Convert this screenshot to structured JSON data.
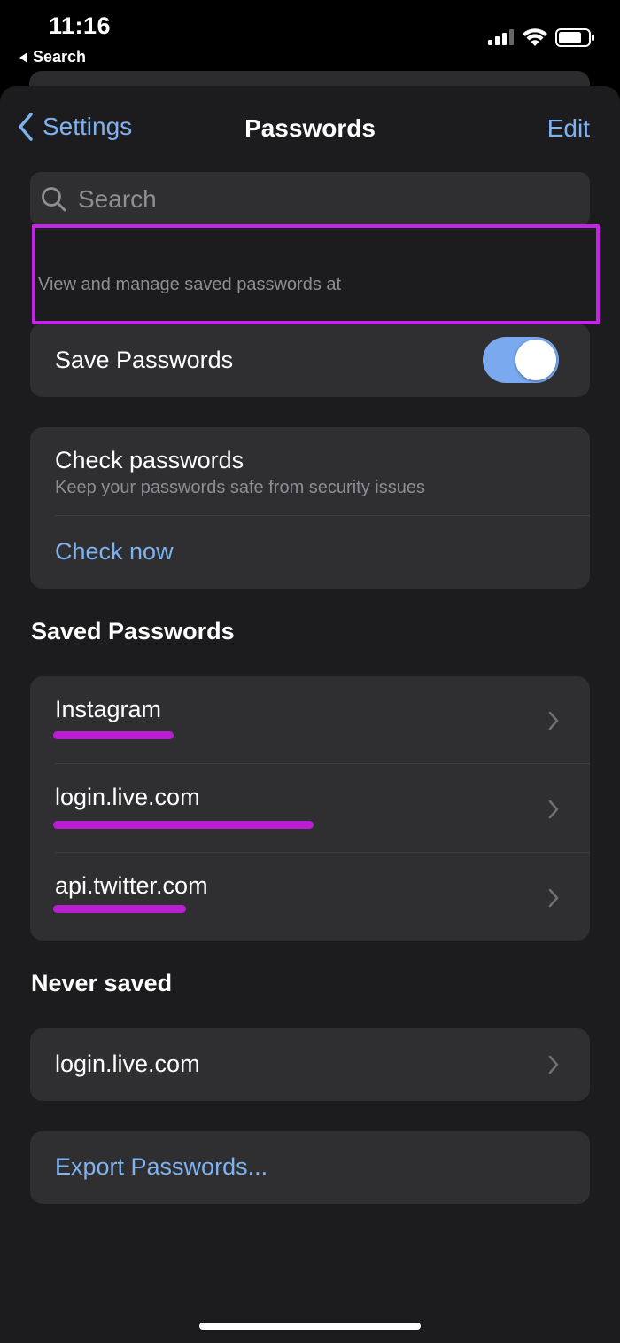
{
  "status_bar": {
    "time": "11:16",
    "back_app_label": "Search"
  },
  "nav": {
    "back_label": "Settings",
    "title": "Passwords",
    "edit_label": "Edit"
  },
  "search": {
    "placeholder": "Search"
  },
  "hint_text": "View and manage saved passwords at",
  "save_passwords": {
    "label": "Save Passwords",
    "enabled": true
  },
  "check_passwords": {
    "title": "Check passwords",
    "subtitle": "Keep your passwords safe from security issues",
    "action_label": "Check now"
  },
  "saved_passwords": {
    "heading": "Saved Passwords",
    "items": [
      {
        "site": "Instagram"
      },
      {
        "site": "login.live.com"
      },
      {
        "site": "api.twitter.com"
      }
    ]
  },
  "never_saved": {
    "heading": "Never saved",
    "items": [
      {
        "site": "login.live.com"
      }
    ]
  },
  "export_label": "Export Passwords...",
  "colors": {
    "accent": "#7fb2f0",
    "highlight": "#c324e6",
    "toggle_on": "#7aa9ef"
  }
}
